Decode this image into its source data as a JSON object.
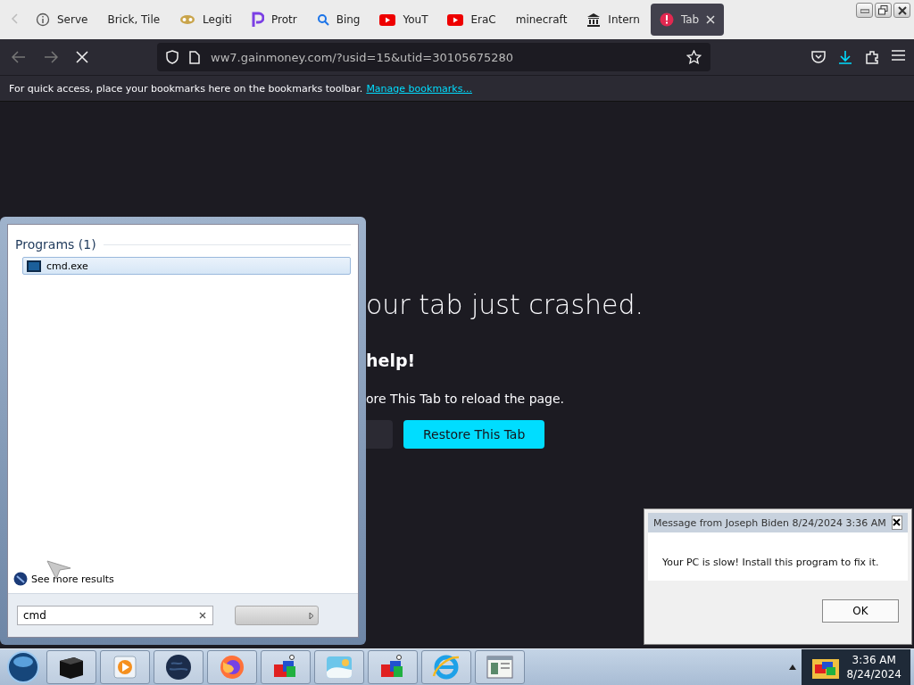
{
  "browser": {
    "tabs": [
      {
        "label": "Serve",
        "kind": "info",
        "selected": false
      },
      {
        "label": "Brick, Tile",
        "kind": "none",
        "selected": false
      },
      {
        "label": "Legiti",
        "kind": "mask",
        "selected": false
      },
      {
        "label": "Protr",
        "kind": "letter",
        "selected": false
      },
      {
        "label": "Bing",
        "kind": "search",
        "selected": false
      },
      {
        "label": "YouT",
        "kind": "video",
        "selected": false
      },
      {
        "label": "EraC",
        "kind": "video",
        "selected": false
      },
      {
        "label": "minecraft",
        "kind": "none",
        "selected": false
      },
      {
        "label": "Intern",
        "kind": "building",
        "selected": false
      },
      {
        "label": "Tab",
        "kind": "alert",
        "selected": true
      }
    ],
    "url": "ww7.gainmoney.com/?usid=15&utid=30105675280",
    "bookmarks_hint": "For quick access, place your bookmarks here on the bookmarks toolbar.",
    "bookmarks_link": "Manage bookmarks..."
  },
  "crash_page": {
    "heading": "our tab just crashed.",
    "subheading": "help!",
    "text": "ore This Tab to reload the page.",
    "restore_button": "Restore This Tab"
  },
  "start_menu": {
    "group": "Programs (1)",
    "results": [
      {
        "label": "cmd.exe",
        "selected": true
      }
    ],
    "more": "See more results",
    "search_value": "cmd"
  },
  "dialog": {
    "title": "Message from Joseph Biden 8/24/2024 3:36 AM",
    "message": "Your PC is slow! Install this program to fix it.",
    "ok": "OK"
  },
  "taskbar": {
    "apps": [
      {
        "kind": "box"
      },
      {
        "kind": "media"
      },
      {
        "kind": "globe"
      },
      {
        "kind": "fox"
      },
      {
        "kind": "blocks"
      },
      {
        "kind": "photo"
      },
      {
        "kind": "blocks"
      },
      {
        "kind": "ie"
      },
      {
        "kind": "window"
      }
    ],
    "time": "3:36 AM",
    "date": "8/24/2024"
  }
}
